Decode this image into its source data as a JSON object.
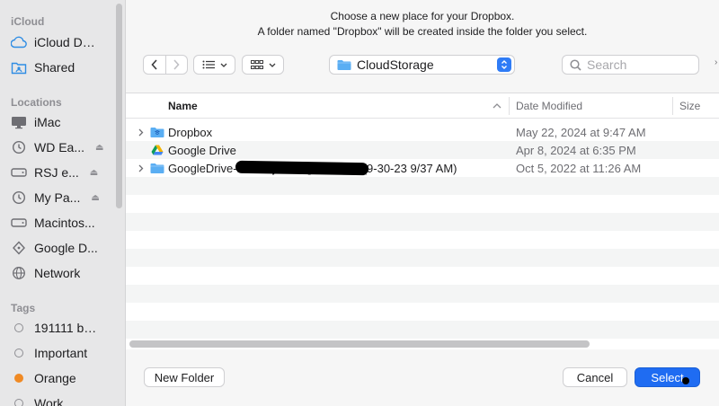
{
  "sidebar": {
    "sections": {
      "icloud": "iCloud",
      "locations": "Locations",
      "tags": "Tags"
    },
    "icloud_items": [
      {
        "label": "iCloud Dri...",
        "icon": "cloud-icon"
      },
      {
        "label": "Shared",
        "icon": "shared-folder-icon"
      }
    ],
    "location_items": [
      {
        "label": "iMac",
        "icon": "computer-icon",
        "eject": false
      },
      {
        "label": "WD Ea...",
        "icon": "time-machine-icon",
        "eject": true
      },
      {
        "label": "RSJ e...",
        "icon": "drive-icon",
        "eject": true
      },
      {
        "label": "My Pa...",
        "icon": "time-machine-icon",
        "eject": true
      },
      {
        "label": "Macintos...",
        "icon": "drive-icon",
        "eject": false
      },
      {
        "label": "Google D...",
        "icon": "drive-icon",
        "eject": false
      },
      {
        "label": "Network",
        "icon": "network-icon",
        "eject": false
      }
    ],
    "tag_items": [
      {
        "label": "191111 ba...",
        "color": ""
      },
      {
        "label": "Important",
        "color": ""
      },
      {
        "label": "Orange",
        "color": "#f08a24"
      },
      {
        "label": "Work",
        "color": ""
      }
    ]
  },
  "dialog": {
    "prompt_line1": "Choose a new place for your Dropbox.",
    "prompt_line2": "A folder named \"Dropbox\" will be created inside the folder you select.",
    "location": "CloudStorage",
    "search_placeholder": "Search"
  },
  "columns": {
    "name": "Name",
    "date": "Date Modified",
    "size": "Size"
  },
  "files": [
    {
      "name": "Dropbox",
      "date": "May 22, 2024 at 9:47 AM",
      "icon": "dropbox-folder-icon",
      "expandable": true
    },
    {
      "name": "Google Drive",
      "date": "Apr 8, 2024 at 6:35 PM",
      "icon": "google-drive-icon",
      "expandable": false
    },
    {
      "name": "GoogleDrive-richardjeffe@gmail.com (9-30-23 9/37 AM)",
      "date": "Oct 5, 2022 at 11:26 AM",
      "icon": "folder-icon",
      "expandable": true
    }
  ],
  "footer": {
    "new_folder": "New Folder",
    "cancel": "Cancel",
    "select": "Select"
  },
  "colors": {
    "accent": "#1f6cf2",
    "sidebar_bg": "#e7e7e8",
    "folder": "#5aaef3"
  }
}
